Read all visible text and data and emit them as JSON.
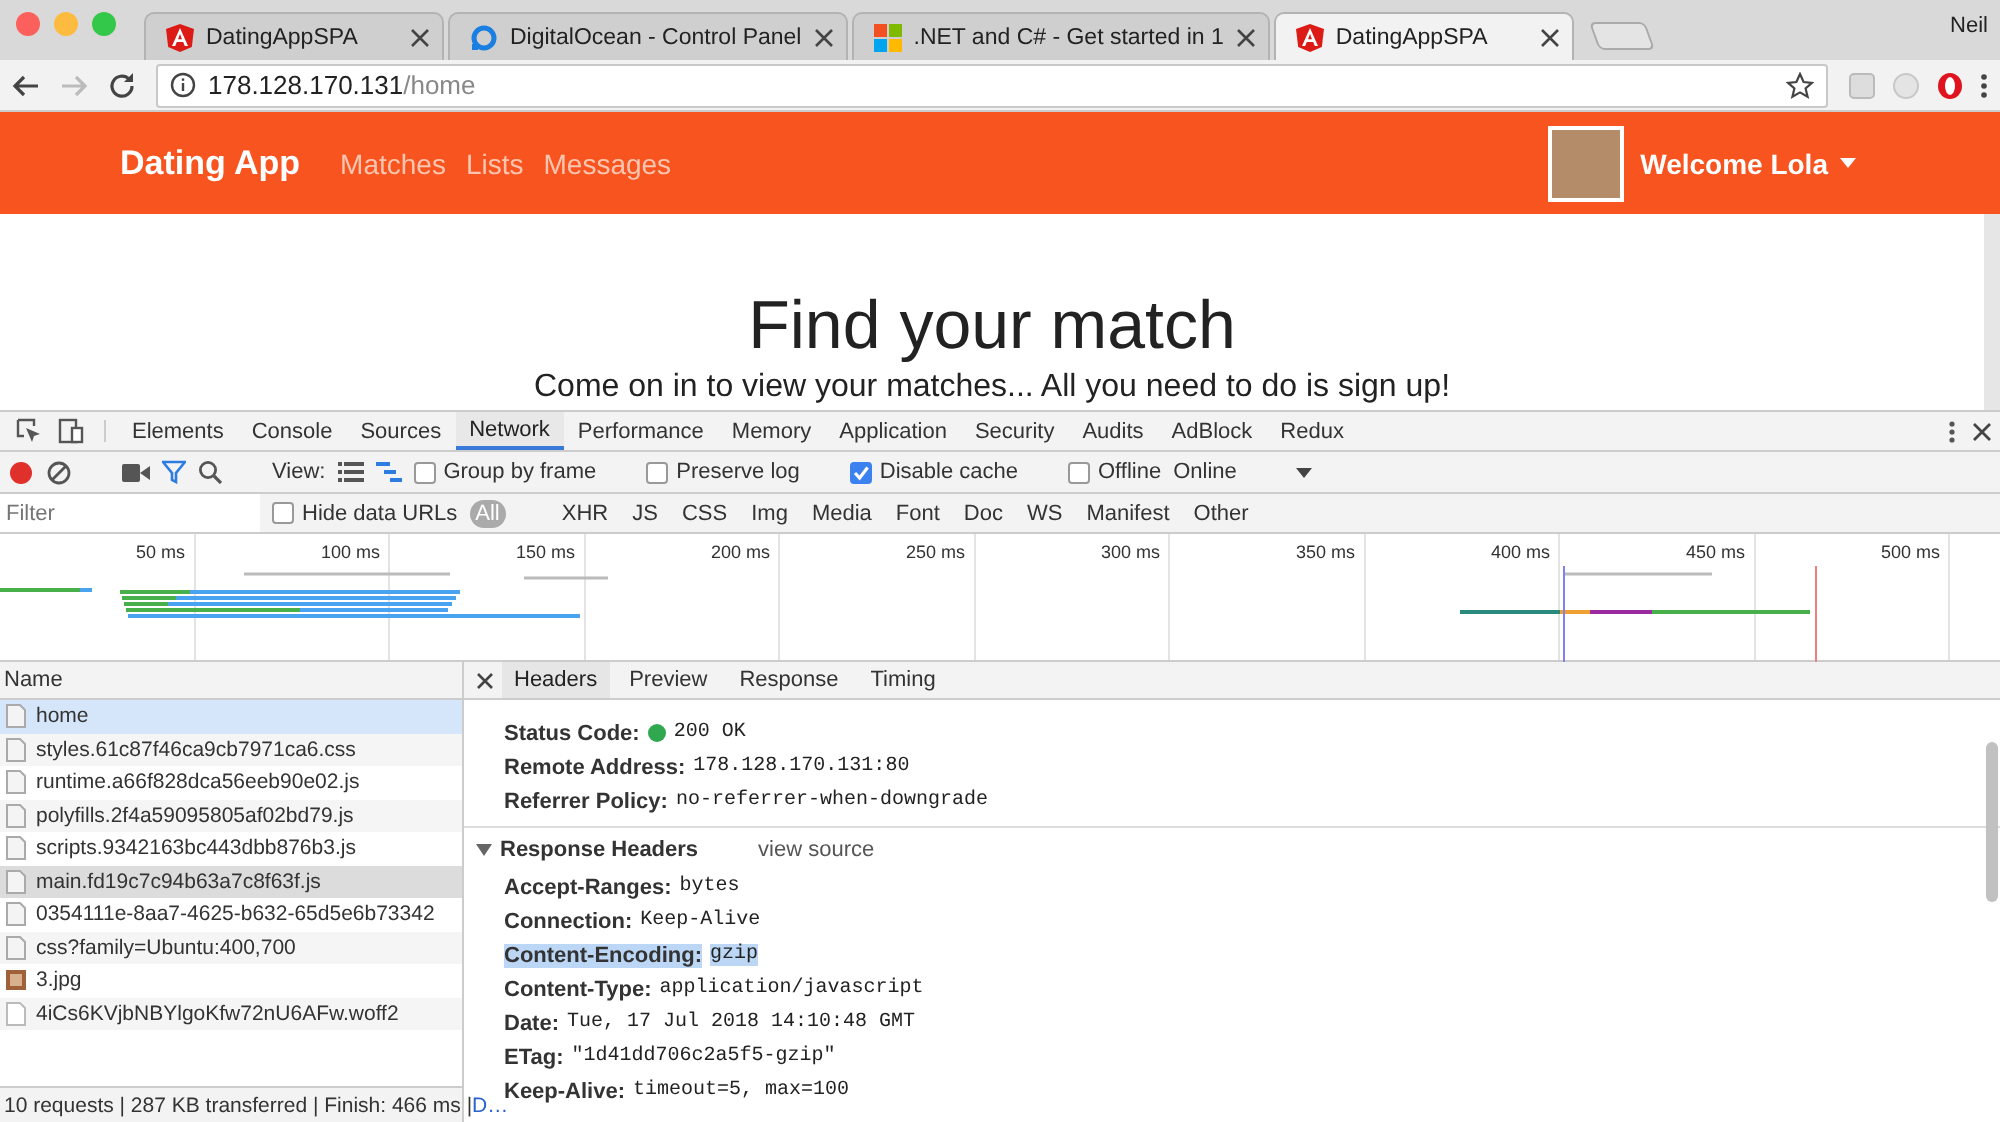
{
  "browser": {
    "tabs": [
      {
        "title": "DatingAppSPA",
        "kind": "angular",
        "selected": false
      },
      {
        "title": "DigitalOcean - Control Panel",
        "kind": "ocean",
        "selected": false
      },
      {
        "title": ".NET and C# - Get started in 1",
        "kind": "windows",
        "selected": false
      },
      {
        "title": "DatingAppSPA",
        "kind": "angular",
        "selected": true
      }
    ],
    "profile": "Neil",
    "address": {
      "host": "178.128.170.131",
      "path": "/home"
    }
  },
  "app": {
    "brand": "Dating App",
    "nav_links": [
      "Matches",
      "Lists",
      "Messages"
    ],
    "greeting": "Welcome Lola",
    "hero": {
      "title": "Find your match",
      "subtitle": "Come on in to view your matches... All you need to do is sign up!"
    }
  },
  "devtools": {
    "panels": [
      {
        "label": "Elements",
        "selected": false
      },
      {
        "label": "Console",
        "selected": false
      },
      {
        "label": "Sources",
        "selected": false
      },
      {
        "label": "Network",
        "selected": true
      },
      {
        "label": "Performance",
        "selected": false
      },
      {
        "label": "Memory",
        "selected": false
      },
      {
        "label": "Application",
        "selected": false
      },
      {
        "label": "Security",
        "selected": false
      },
      {
        "label": "Audits",
        "selected": false
      },
      {
        "label": "AdBlock",
        "selected": false
      },
      {
        "label": "Redux",
        "selected": false
      }
    ],
    "recording": true,
    "view_label": "View:",
    "options": [
      {
        "label": "Group by frame",
        "checked": false
      },
      {
        "label": "Preserve log",
        "checked": false
      },
      {
        "label": "Disable cache",
        "checked": true
      },
      {
        "label": "Offline",
        "checked": false
      }
    ],
    "throttling": "Online",
    "filter": {
      "placeholder": "Filter"
    },
    "hide_data_urls": {
      "label": "Hide data URLs",
      "checked": false
    },
    "types": [
      {
        "label": "All",
        "selected": true
      },
      {
        "label": "XHR",
        "selected": false
      },
      {
        "label": "JS",
        "selected": false
      },
      {
        "label": "CSS",
        "selected": false
      },
      {
        "label": "Img",
        "selected": false
      },
      {
        "label": "Media",
        "selected": false
      },
      {
        "label": "Font",
        "selected": false
      },
      {
        "label": "Doc",
        "selected": false
      },
      {
        "label": "WS",
        "selected": false
      },
      {
        "label": "Manifest",
        "selected": false
      },
      {
        "label": "Other",
        "selected": false
      }
    ],
    "timeline_ticks": [
      "50 ms",
      "100 ms",
      "150 ms",
      "200 ms",
      "250 ms",
      "300 ms",
      "350 ms",
      "400 ms",
      "450 ms",
      "500 ms"
    ],
    "list_heading": "Name",
    "requests": [
      {
        "name": "home",
        "kind": "file",
        "selected": true,
        "hovered": false
      },
      {
        "name": "styles.61c87f46ca9cb7971ca6.css",
        "kind": "file",
        "selected": false,
        "hovered": false
      },
      {
        "name": "runtime.a66f828dca56eeb90e02.js",
        "kind": "file",
        "selected": false,
        "hovered": false
      },
      {
        "name": "polyfills.2f4a59095805af02bd79.js",
        "kind": "file",
        "selected": false,
        "hovered": false
      },
      {
        "name": "scripts.9342163bc443dbb876b3.js",
        "kind": "file",
        "selected": false,
        "hovered": false
      },
      {
        "name": "main.fd19c7c94b63a7c8f63f.js",
        "kind": "file",
        "selected": false,
        "hovered": true
      },
      {
        "name": "0354111e-8aa7-4625-b632-65d5e6b73342",
        "kind": "file",
        "selected": false,
        "hovered": false
      },
      {
        "name": "css?family=Ubuntu:400,700",
        "kind": "file",
        "selected": false,
        "hovered": false
      },
      {
        "name": "3.jpg",
        "kind": "image",
        "selected": false,
        "hovered": false
      },
      {
        "name": "4iCs6KVjbNBYlgoKfw72nU6AFw.woff2",
        "kind": "font",
        "selected": false,
        "hovered": false
      }
    ],
    "summary": "10 requests | 287 KB transferred | Finish: 466 ms | ",
    "summary_link": "D…",
    "detail_tabs": [
      {
        "label": "Headers",
        "selected": true
      },
      {
        "label": "Preview",
        "selected": false
      },
      {
        "label": "Response",
        "selected": false
      },
      {
        "label": "Timing",
        "selected": false
      }
    ],
    "general": [
      {
        "name": "Status Code:",
        "value": "200 OK",
        "color": "#2fa84f"
      },
      {
        "name": "Remote Address:",
        "value": "178.128.170.131:80"
      },
      {
        "name": "Referrer Policy:",
        "value": "no-referrer-when-downgrade"
      }
    ],
    "response_section": {
      "title": "Response Headers",
      "expanded": true,
      "link": "view source"
    },
    "response_headers": [
      {
        "name": "Accept-Ranges:",
        "value": "bytes",
        "highlighted": false
      },
      {
        "name": "Connection:",
        "value": "Keep-Alive",
        "highlighted": false
      },
      {
        "name": "Content-Encoding:",
        "value": "gzip",
        "highlighted": true
      },
      {
        "name": "Content-Type:",
        "value": "application/javascript",
        "highlighted": false
      },
      {
        "name": "Date:",
        "value": "Tue, 17 Jul 2018 14:10:48 GMT",
        "highlighted": false
      },
      {
        "name": "ETag:",
        "value": "\"1d41dd706c2a5f5-gzip\"",
        "highlighted": false
      },
      {
        "name": "Keep-Alive:",
        "value": "timeout=5, max=100",
        "highlighted": false
      }
    ]
  }
}
